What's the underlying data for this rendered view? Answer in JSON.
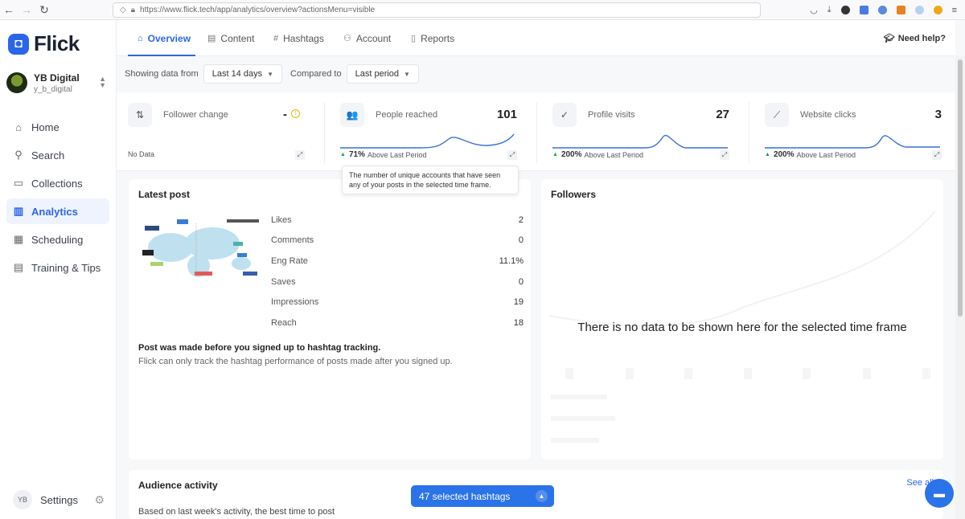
{
  "browser": {
    "url": "https://www.flick.tech/app/analytics/overview?actionsMenu=visible",
    "back_icon": "arrow-left-icon",
    "forward_icon": "arrow-right-icon",
    "reload_icon": "reload-icon"
  },
  "brand": {
    "name": "Flick",
    "color": "#2b66e8"
  },
  "account": {
    "name": "YB Digital",
    "handle": "y_b_digital"
  },
  "sidebar": {
    "items": [
      {
        "label": "Home",
        "icon": "home-icon",
        "glyph": "⌂",
        "active": false
      },
      {
        "label": "Search",
        "icon": "search-icon",
        "glyph": "⚲",
        "active": false
      },
      {
        "label": "Collections",
        "icon": "folder-icon",
        "glyph": "▭",
        "active": false
      },
      {
        "label": "Analytics",
        "icon": "bar-chart-icon",
        "glyph": "▥",
        "active": true
      },
      {
        "label": "Scheduling",
        "icon": "calendar-icon",
        "glyph": "▦",
        "active": false
      },
      {
        "label": "Training & Tips",
        "icon": "book-icon",
        "glyph": "▤",
        "active": false
      }
    ],
    "settings_badge": "YB",
    "settings_label": "Settings"
  },
  "tabs": [
    {
      "label": "Overview",
      "glyph": "⌂",
      "active": true
    },
    {
      "label": "Content",
      "glyph": "▤",
      "active": false
    },
    {
      "label": "Hashtags",
      "glyph": "#",
      "active": false
    },
    {
      "label": "Account",
      "glyph": "⚇",
      "active": false
    },
    {
      "label": "Reports",
      "glyph": "▯",
      "active": false
    }
  ],
  "need_help": "Need help?",
  "filters": {
    "showing_label": "Showing data from",
    "range_value": "Last 14 days",
    "compared_label": "Compared to",
    "compare_value": "Last period"
  },
  "stats": [
    {
      "title": "Follower change",
      "value": "-",
      "icon": "arrows-updown-icon",
      "glyph": "⇅",
      "footer_value": "",
      "footer_text": "No Data",
      "has_trend": false
    },
    {
      "title": "People reached",
      "value": "101",
      "icon": "people-icon",
      "glyph": "👥",
      "footer_value": "71%",
      "footer_text": "Above Last Period",
      "has_trend": true
    },
    {
      "title": "Profile visits",
      "value": "27",
      "icon": "profile-check-icon",
      "glyph": "✓",
      "footer_value": "200%",
      "footer_text": "Above Last Period",
      "has_trend": true
    },
    {
      "title": "Website clicks",
      "value": "3",
      "icon": "trend-icon",
      "glyph": "⟋",
      "footer_value": "200%",
      "footer_text": "Above Last Period",
      "has_trend": true
    }
  ],
  "tooltip": "The number of unique accounts that have seen any of your posts in the selected time frame.",
  "latest_post": {
    "title": "Latest post",
    "metrics": [
      {
        "label": "Likes",
        "value": "2"
      },
      {
        "label": "Comments",
        "value": "0"
      },
      {
        "label": "Eng Rate",
        "value": "11.1%"
      },
      {
        "label": "Saves",
        "value": "0"
      },
      {
        "label": "Impressions",
        "value": "19"
      },
      {
        "label": "Reach",
        "value": "18"
      }
    ],
    "note_title": "Post was made before you signed up to hashtag tracking.",
    "note_body": "Flick can only track the hashtag performance of posts made after you signed up."
  },
  "followers": {
    "title": "Followers",
    "empty_message": "There is no data to be shown here for the selected time frame"
  },
  "audience": {
    "title": "Audience activity",
    "see_all": "See all",
    "subtitle": "Based on last week's activity, the best time to post"
  },
  "hashtag_pill": {
    "label": "47 selected hashtags"
  },
  "colors": {
    "accent": "#2b66e8",
    "positive": "#19a25c",
    "pill": "#2b73e8"
  }
}
